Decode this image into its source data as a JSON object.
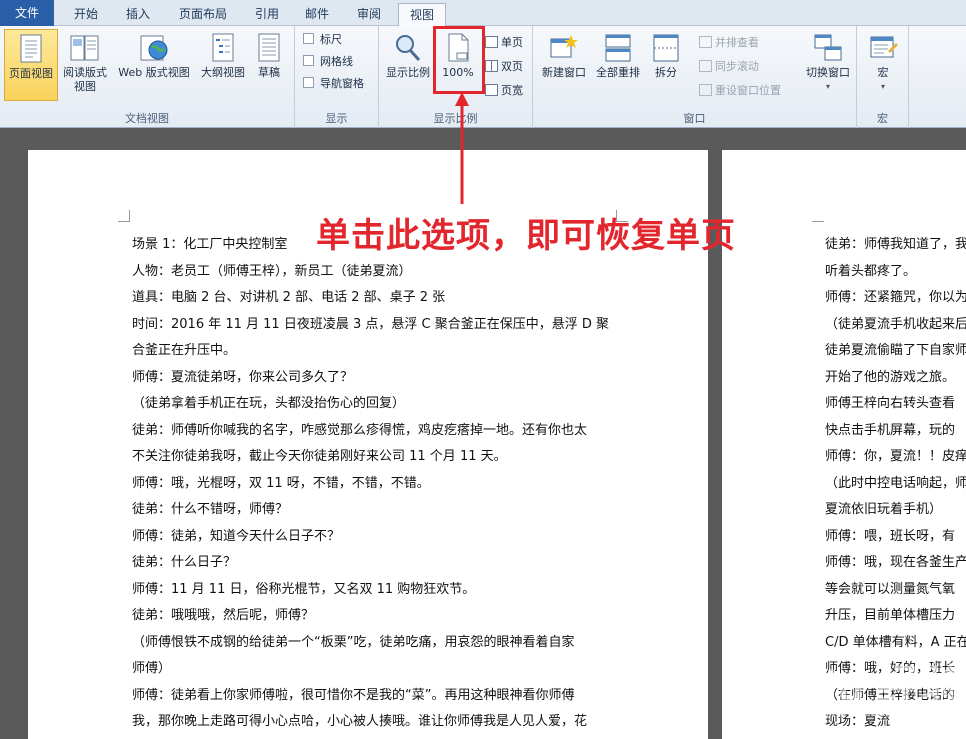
{
  "tabs": [
    {
      "label": "文件"
    },
    {
      "label": "开始"
    },
    {
      "label": "插入"
    },
    {
      "label": "页面布局"
    },
    {
      "label": "引用"
    },
    {
      "label": "邮件"
    },
    {
      "label": "审阅"
    },
    {
      "label": "视图"
    }
  ],
  "ribbon": {
    "doc_views": {
      "group_label": "文档视图",
      "page_view": "页面视图",
      "read_view": "阅读版式视图",
      "web_view": "Web 版式视图",
      "outline_view": "大纲视图",
      "draft": "草稿"
    },
    "show": {
      "group_label": "显示",
      "ruler": "标尺",
      "gridlines": "网格线",
      "nav_pane": "导航窗格"
    },
    "zoom": {
      "group_label": "显示比例",
      "zoom": "显示比例",
      "hundred": "100%",
      "one_page": "单页",
      "two_pages": "双页",
      "page_width": "页宽"
    },
    "window": {
      "group_label": "窗口",
      "new_window": "新建窗口",
      "arrange_all": "全部重排",
      "split": "拆分",
      "side_by_side": "并排查看",
      "sync_scroll": "同步滚动",
      "reset_pos": "重设窗口位置",
      "switch": "切换窗口"
    },
    "macros": {
      "group_label": "宏",
      "macros": "宏"
    }
  },
  "annotation": {
    "text": "单击此选项，即可恢复单页"
  },
  "page1": {
    "lines": [
      "场景 1：化工厂中央控制室",
      "人物：老员工（师傅王梓），新员工（徒弟夏流）",
      "道具：电脑 2 台、对讲机 2 部、电话 2 部、桌子 2 张",
      "时间：2016 年 11 月 11 日夜班凌晨 3 点，悬浮 C 聚合釜正在保压中，悬浮 D 聚",
      "合釜正在升压中。",
      "师傅：夏流徒弟呀，你来公司多久了？",
      "（徒弟拿着手机正在玩，头都没抬伤心的回复）",
      "徒弟：师傅听你喊我的名字，咋感觉那么疹得慌，鸡皮疙瘩掉一地。还有你也太",
      "不关注你徒弟我呀，截止今天你徒弟刚好来公司 11 个月 11 天。",
      "师傅：哦，光棍呀，双 11 呀，不错，不错，不错。",
      "徒弟：什么不错呀，师傅？",
      "师傅：徒弟，知道今天什么日子不？",
      "徒弟：什么日子？",
      "师傅：11 月 11 日，俗称光棍节，又名双 11 购物狂欢节。",
      "徒弟：哦哦哦，然后呢，师傅？",
      "（师傅恨铁不成钢的给徒弟一个“板栗”吃，徒弟吃痛，用哀怨的眼神看着自家",
      "师傅）",
      "师傅：徒弟看上你家师傅啦，很可惜你不是我的“菜”。再用这种眼神看你师傅",
      "我，那你晚上走路可得小心点哈，小心被人揍哦。谁让你师傅我是人见人爱，花"
    ]
  },
  "page2": {
    "lines": [
      "徒弟：师傅我知道了，我",
      "听着头都疼了。",
      "师傅：还紧箍咒，你以为",
      "（徒弟夏流手机收起来后",
      "徒弟夏流偷瞄了下自家师",
      "开始了他的游戏之旅。",
      "师傅王梓向右转头查看",
      "快点击手机屏幕，玩的",
      "师傅：你，夏流！！皮痒",
      "（此时中控电话响起，师",
      "夏流依旧玩着手机）",
      "师傅：喂，班长呀，有",
      "师傅：哦，现在各釜生产",
      "等会就可以测量氮气氧",
      "升压，目前单体槽压力",
      "C/D 单体槽有料，A 正在",
      "师傅：哦，好的，班长",
      "（在师傅王梓接电话的",
      "现场：夏流"
    ]
  },
  "watermark": {
    "logo": "Baidu 经验",
    "url": "jingyan.baidu.com"
  }
}
